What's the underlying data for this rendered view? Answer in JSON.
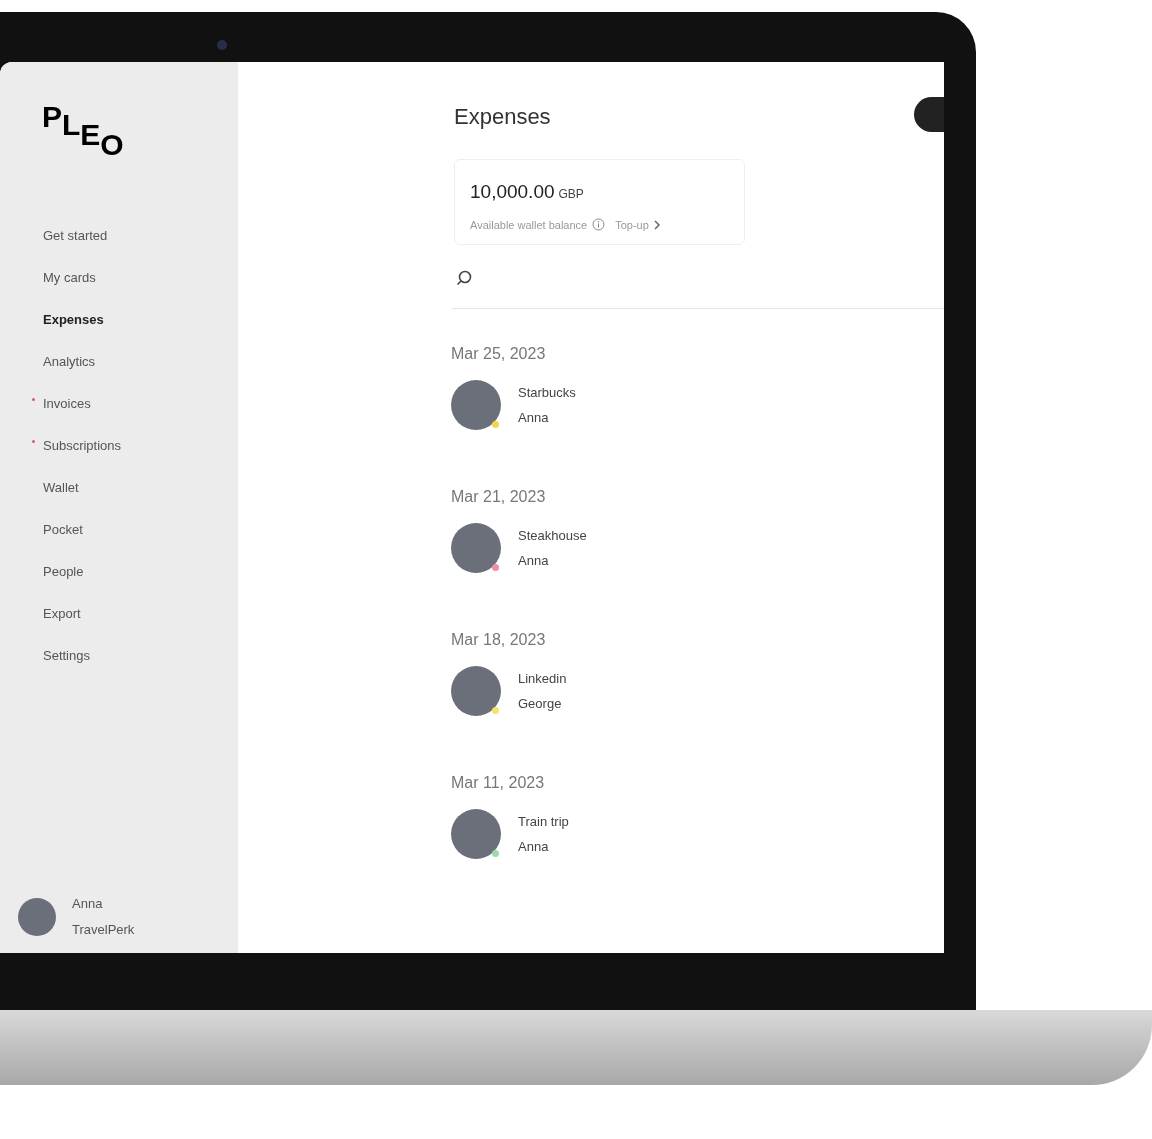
{
  "sidebar": {
    "logo": "PLEO",
    "items": [
      {
        "label": "Get started",
        "selected": false,
        "badge": false
      },
      {
        "label": "My cards",
        "selected": false,
        "badge": false
      },
      {
        "label": "Expenses",
        "selected": true,
        "badge": false
      },
      {
        "label": "Analytics",
        "selected": false,
        "badge": false
      },
      {
        "label": "Invoices",
        "selected": false,
        "badge": true
      },
      {
        "label": "Subscriptions",
        "selected": false,
        "badge": true
      },
      {
        "label": "Wallet",
        "selected": false,
        "badge": false
      },
      {
        "label": "Pocket",
        "selected": false,
        "badge": false
      },
      {
        "label": "People",
        "selected": false,
        "badge": false
      },
      {
        "label": "Export",
        "selected": false,
        "badge": false
      },
      {
        "label": "Settings",
        "selected": false,
        "badge": false
      }
    ],
    "user": {
      "name": "Anna",
      "company": "TravelPerk"
    }
  },
  "page_title": "Expenses",
  "wallet": {
    "amount": "10,000.00",
    "currency": "GBP",
    "caption": "Available wallet balance",
    "link": "Top-up"
  },
  "expense_groups": [
    {
      "date": "Mar 25, 2023",
      "expenses": [
        {
          "merchant": "Starbucks",
          "person": "Anna",
          "color": "#f2d64b"
        }
      ]
    },
    {
      "date": "Mar 21, 2023",
      "expenses": [
        {
          "merchant": "Steakhouse",
          "person": "Anna",
          "color": "#ef8fa0"
        }
      ]
    },
    {
      "date": "Mar 18, 2023",
      "expenses": [
        {
          "merchant": "Linkedin",
          "person": "George",
          "color": "#f2e46b"
        }
      ]
    },
    {
      "date": "Mar 11, 2023",
      "expenses": [
        {
          "merchant": "Train trip",
          "person": "Anna",
          "color": "#9fd9a8"
        }
      ]
    }
  ]
}
